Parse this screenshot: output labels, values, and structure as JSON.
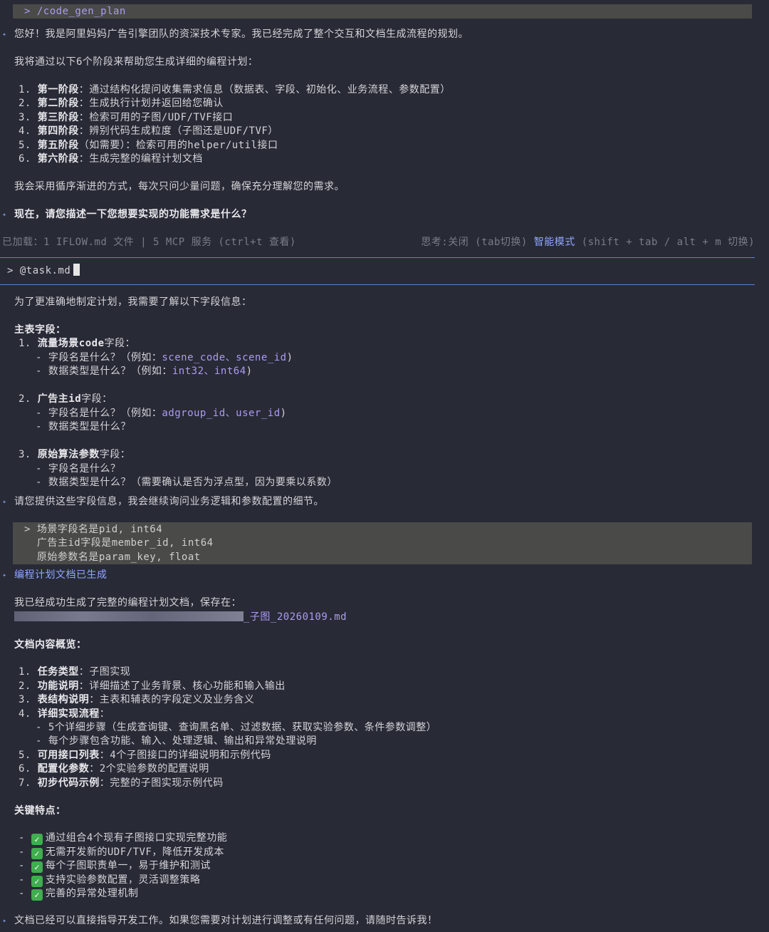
{
  "cmd1": "> /code_gen_plan",
  "greeting": "您好！我是阿里妈妈广告引擎团队的资深技术专家。我已经完成了整个交互和文档生成流程的规划。",
  "intro": "我将通过以下6个阶段来帮助您生成详细的编程计划：",
  "phases": [
    {
      "n": "1.",
      "b": "第一阶段",
      "t": "：通过结构化提问收集需求信息（数据表、字段、初始化、业务流程、参数配置）"
    },
    {
      "n": "2.",
      "b": "第二阶段",
      "t": "：生成执行计划并返回给您确认"
    },
    {
      "n": "3.",
      "b": "第三阶段",
      "t": "：检索可用的子图/UDF/TVF接口"
    },
    {
      "n": "4.",
      "b": "第四阶段",
      "t": "：辨别代码生成粒度（子图还是UDF/TVF）"
    },
    {
      "n": "5.",
      "b": "第五阶段",
      "t": "（如需要）：检索可用的helper/util接口"
    },
    {
      "n": "6.",
      "b": "第六阶段",
      "t": "：生成完整的编程计划文档"
    }
  ],
  "loop_note": "我会采用循序渐进的方式，每次只问少量问题，确保充分理解您的需求。",
  "question": "现在，请您描述一下您想要实现的功能需求是什么？",
  "status": {
    "left": "已加载：1 IFLOW.md 文件 | 5 MCP 服务 (ctrl+t 查看)",
    "think": "思考:关闭 (tab切换)",
    "mode": "智能模式",
    "mode_hint": "(shift + tab / alt + m 切换)"
  },
  "input_prompt": "> @task.md",
  "need_info": "为了更准确地制定计划，我需要了解以下字段信息：",
  "main_fields": "主表字段：",
  "f1": {
    "n": "1.",
    "b": "流量场景code",
    "t": "字段："
  },
  "f1_a_pre": "- 字段名是什么？（例如：",
  "f1_a_ex": "scene_code、scene_id",
  "f1_a_post": ")",
  "f1_b_pre": "- 数据类型是什么？（例如：",
  "f1_b_ex": "int32、int64",
  "f1_b_post": ")",
  "f2": {
    "n": "2.",
    "b": "广告主id",
    "t": "字段："
  },
  "f2_a_pre": "- 字段名是什么？（例如：",
  "f2_a_ex": "adgroup_id、user_id",
  "f2_a_post": ")",
  "f2_b": "- 数据类型是什么？",
  "f3": {
    "n": "3.",
    "b": "原始算法参数",
    "t": "字段："
  },
  "f3_a": "- 字段名是什么？",
  "f3_b": "- 数据类型是什么？（需要确认是否为浮点型，因为要乘以系数）",
  "ask_more": "请您提供这些字段信息，我会继续询问业务逻辑和参数配置的细节。",
  "reply": [
    "> 场景字段名是pid, int64",
    "  广告主id字段是member_id, int64",
    "  原始参数名是param_key, float"
  ],
  "doc_done": "编程计划文档已生成",
  "saved_at": "我已经成功生成了完整的编程计划文档，保存在：",
  "file_suffix": "_子图_20260109.md",
  "overview": "文档内容概览：",
  "items": [
    {
      "n": "1.",
      "b": "任务类型",
      "t": "：子图实现"
    },
    {
      "n": "2.",
      "b": "功能说明",
      "t": "：详细描述了业务背景、核心功能和输入输出"
    },
    {
      "n": "3.",
      "b": "表结构说明",
      "t": "：主表和辅表的字段定义及业务含义"
    },
    {
      "n": "4.",
      "b": "详细实现流程",
      "t": "："
    }
  ],
  "sub4a": "- 5个详细步骤（生成查询键、查询黑名单、过滤数据、获取实验参数、条件参数调整）",
  "sub4b": "- 每个步骤包含功能、输入、处理逻辑、输出和异常处理说明",
  "items2": [
    {
      "n": "5.",
      "b": "可用接口列表",
      "t": "：4个子图接口的详细说明和示例代码"
    },
    {
      "n": "6.",
      "b": "配置化参数",
      "t": "：2个实验参数的配置说明"
    },
    {
      "n": "7.",
      "b": "初步代码示例",
      "t": "：完整的子图实现示例代码"
    }
  ],
  "key_points": "关键特点：",
  "features": [
    "通过组合4个现有子图接口实现完整功能",
    "无需开发新的UDF/TVF，降低开发成本",
    "每个子图职责单一，易于维护和测试",
    "支持实验参数配置，灵活调整策略",
    "完善的异常处理机制"
  ],
  "final": "文档已经可以直接指导开发工作。如果您需要对计划进行调整或有任何问题，请随时告诉我！"
}
